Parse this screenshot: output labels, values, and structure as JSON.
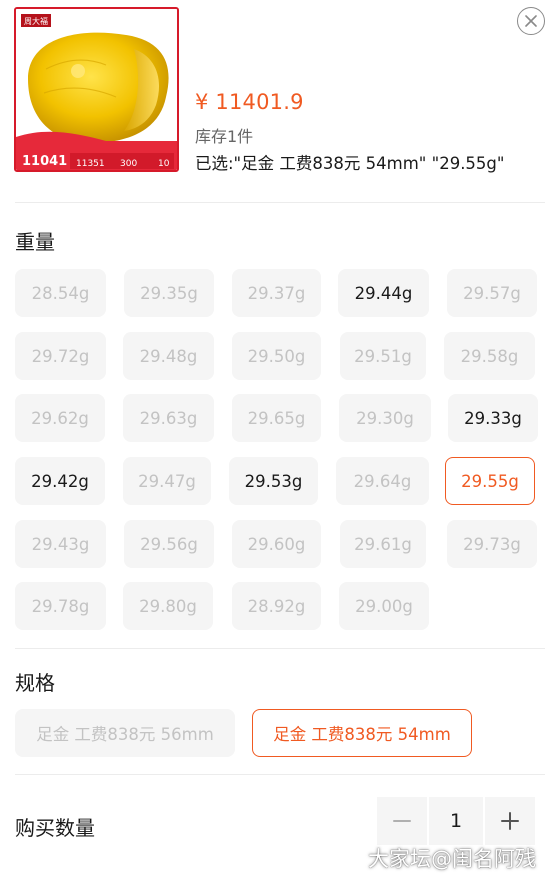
{
  "product": {
    "price": "¥ 11401.9",
    "stock": "库存1件",
    "selected": "已选:\"足金 工费838元 54mm\" \"29.55g\"",
    "image": {
      "brand_text": "周大福",
      "banner_price": "11041",
      "banner_stats": [
        "11351",
        "300",
        "10"
      ]
    }
  },
  "weight_section": {
    "title": "重量",
    "options": [
      {
        "label": "28.54g",
        "state": "disabled"
      },
      {
        "label": "29.35g",
        "state": "disabled"
      },
      {
        "label": "29.37g",
        "state": "disabled"
      },
      {
        "label": "29.44g",
        "state": "available"
      },
      {
        "label": "29.57g",
        "state": "disabled"
      },
      {
        "label": "29.72g",
        "state": "disabled"
      },
      {
        "label": "29.48g",
        "state": "disabled"
      },
      {
        "label": "29.50g",
        "state": "disabled"
      },
      {
        "label": "29.51g",
        "state": "disabled"
      },
      {
        "label": "29.58g",
        "state": "disabled"
      },
      {
        "label": "29.62g",
        "state": "disabled"
      },
      {
        "label": "29.63g",
        "state": "disabled"
      },
      {
        "label": "29.65g",
        "state": "disabled"
      },
      {
        "label": "29.30g",
        "state": "disabled"
      },
      {
        "label": "29.33g",
        "state": "available"
      },
      {
        "label": "29.42g",
        "state": "available"
      },
      {
        "label": "29.47g",
        "state": "disabled"
      },
      {
        "label": "29.53g",
        "state": "available"
      },
      {
        "label": "29.64g",
        "state": "disabled"
      },
      {
        "label": "29.55g",
        "state": "selected"
      },
      {
        "label": "29.43g",
        "state": "disabled"
      },
      {
        "label": "29.56g",
        "state": "disabled"
      },
      {
        "label": "29.60g",
        "state": "disabled"
      },
      {
        "label": "29.61g",
        "state": "disabled"
      },
      {
        "label": "29.73g",
        "state": "disabled"
      },
      {
        "label": "29.78g",
        "state": "disabled"
      },
      {
        "label": "29.80g",
        "state": "disabled"
      },
      {
        "label": "28.92g",
        "state": "disabled"
      },
      {
        "label": "29.00g",
        "state": "disabled"
      }
    ]
  },
  "spec_section": {
    "title": "规格",
    "options": [
      {
        "label": "足金 工费838元 56mm",
        "state": "disabled"
      },
      {
        "label": "足金 工费838元 54mm",
        "state": "selected"
      }
    ]
  },
  "quantity": {
    "label": "购买数量",
    "value": "1",
    "minus_icon": "minus-icon",
    "plus_icon": "plus-icon"
  },
  "watermark": "大家坛@闺名阿残",
  "colors": {
    "accent": "#f05a22",
    "chip_bg": "#f5f5f5",
    "disabled_text": "#c3c3c3",
    "brand_red": "#d61a2a",
    "gold": "#f2c200"
  }
}
